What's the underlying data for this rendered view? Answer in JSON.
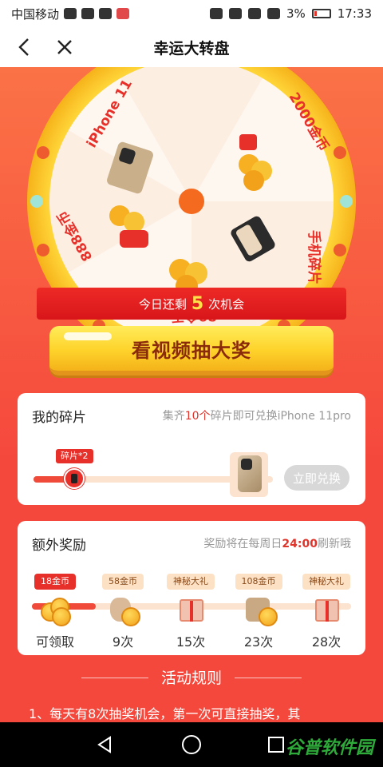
{
  "status_bar": {
    "carrier": "中国移动",
    "battery": "3%",
    "time": "17:33"
  },
  "nav": {
    "title": "幸运大转盘"
  },
  "wheel": {
    "prizes": [
      "iPhone 11",
      "2000金币",
      "手机碎片",
      "89金币",
      "888金币"
    ]
  },
  "chances": {
    "prefix": "今日还剩",
    "count": "5",
    "suffix": "次机会"
  },
  "video_button": {
    "label": "看视频抽大奖"
  },
  "fragments": {
    "title": "我的碎片",
    "hint_prefix": "集齐",
    "hint_count": "10个",
    "hint_suffix": "碎片即可兑换iPhone 11pro",
    "badge": "碎片*2",
    "progress": 0.2,
    "redeem_label": "立即兑换"
  },
  "bonus": {
    "title": "额外奖励",
    "hint_prefix": "奖励将在每周日",
    "hint_time": "24:00",
    "hint_suffix": "刷新哦",
    "items": [
      {
        "tag": "18金币",
        "label": "可领取",
        "icon": "coins-icon"
      },
      {
        "tag": "58金币",
        "label": "9次",
        "icon": "coin-bag-icon"
      },
      {
        "tag": "神秘大礼",
        "label": "15次",
        "icon": "gift-box-icon"
      },
      {
        "tag": "108金币",
        "label": "23次",
        "icon": "treasure-chest-icon"
      },
      {
        "tag": "神秘大礼",
        "label": "28次",
        "icon": "gift-box-icon"
      }
    ]
  },
  "rules": {
    "title": "活动规则",
    "line1": "1、每天有8次抽奖机会，第一次可直接抽奖，其"
  },
  "watermark": "谷普软件园",
  "colors": {
    "accent": "#f5483d",
    "gold": "#fed22a",
    "red": "#e8302a"
  }
}
